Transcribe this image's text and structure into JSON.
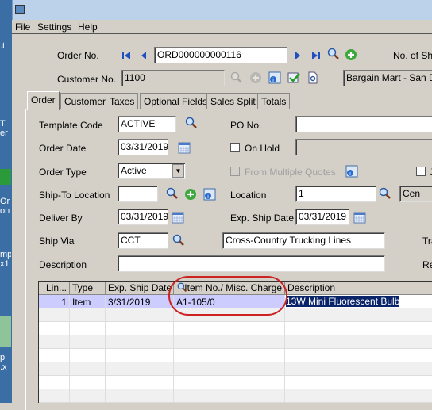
{
  "menu": [
    "File",
    "Settings",
    "Help"
  ],
  "header": {
    "order_no_label": "Order No.",
    "order_no": "ORD000000000116",
    "no_of_ship_label": "No. of Ship",
    "customer_no_label": "Customer No.",
    "customer_no": "1100",
    "customer_name": "Bargain Mart - San Dieg"
  },
  "tabs": [
    "Order",
    "Customer",
    "Taxes",
    "Optional Fields",
    "Sales Split",
    "Totals"
  ],
  "form": {
    "template_code_label": "Template Code",
    "template_code": "ACTIVE",
    "po_no_label": "PO No.",
    "po_no": "",
    "order_date_label": "Order Date",
    "order_date": "03/31/2019",
    "on_hold_label": "On Hold",
    "order_type_label": "Order Type",
    "order_type": "Active",
    "from_multiple_quotes_label": "From Multiple Quotes",
    "cut_check_label": "J",
    "ship_to_label": "Ship-To Location",
    "ship_to": "",
    "location_label": "Location",
    "location": "1",
    "location_desc": "Cen",
    "deliver_by_label": "Deliver By",
    "deliver_by": "03/31/2019",
    "exp_ship_label": "Exp. Ship Date",
    "exp_ship": "03/31/2019",
    "ship_via_label": "Ship Via",
    "ship_via": "CCT",
    "ship_via_desc": "Cross-Country Trucking Lines",
    "tra_label": "Tra",
    "description_label": "Description",
    "description": "",
    "re_label": "Re"
  },
  "grid": {
    "columns": [
      "Lin...",
      "Type",
      "Exp. Ship Date",
      "Item No./ Misc. Charge",
      "Description"
    ],
    "rows": [
      {
        "line": "1",
        "type": "Item",
        "exp_ship_date": "3/31/2019",
        "item_no": "A1-105/0",
        "description": "13W Mini Fluorescent Bulb"
      }
    ]
  },
  "colors": {
    "selected_row": "#ccccff",
    "highlight_desc": "#0a246a",
    "annotation": "#cc2222"
  }
}
